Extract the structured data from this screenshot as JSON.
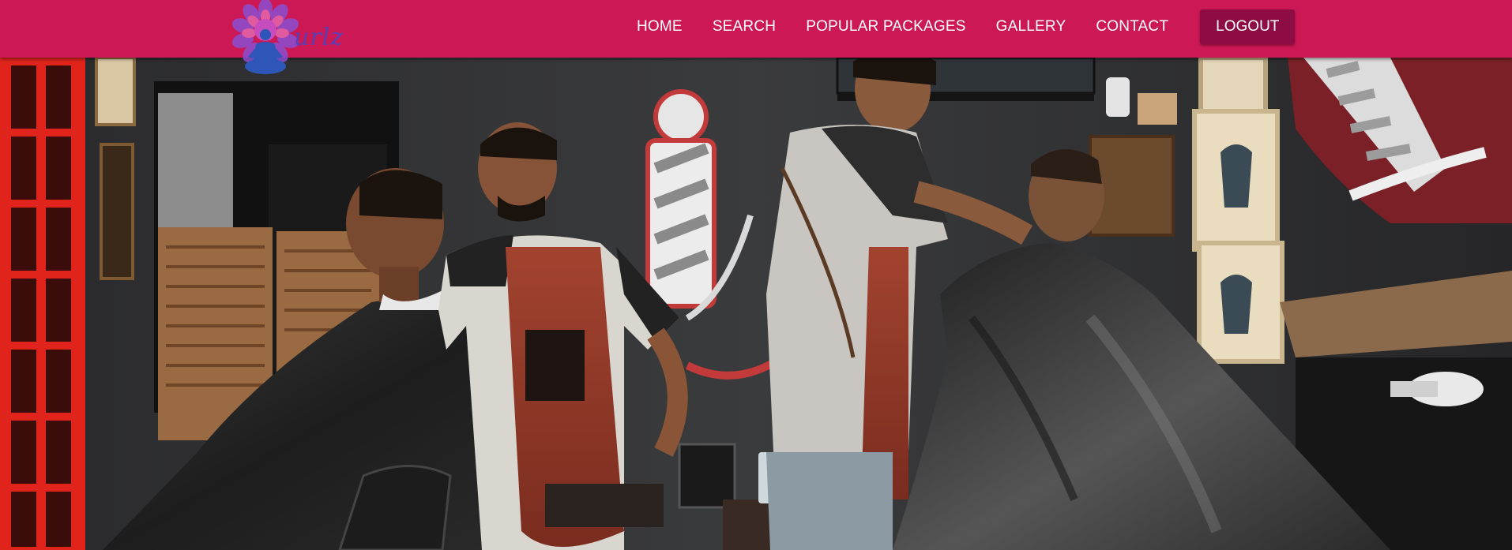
{
  "logo": {
    "text": "urlz",
    "icon": "meditating-figure-mandala-icon"
  },
  "nav": {
    "items": [
      {
        "label": "HOME"
      },
      {
        "label": "SEARCH"
      },
      {
        "label": "POPULAR PACKAGES"
      },
      {
        "label": "GALLERY"
      },
      {
        "label": "CONTACT"
      }
    ],
    "logout_label": "LOGOUT"
  },
  "hero": {
    "image_subject": "barbershop-photo"
  },
  "colors": {
    "navbar": "#cc1855",
    "logout_button": "#8c0c43",
    "nav_text": "#ffffff",
    "logo_text": "#5a3fb4"
  }
}
